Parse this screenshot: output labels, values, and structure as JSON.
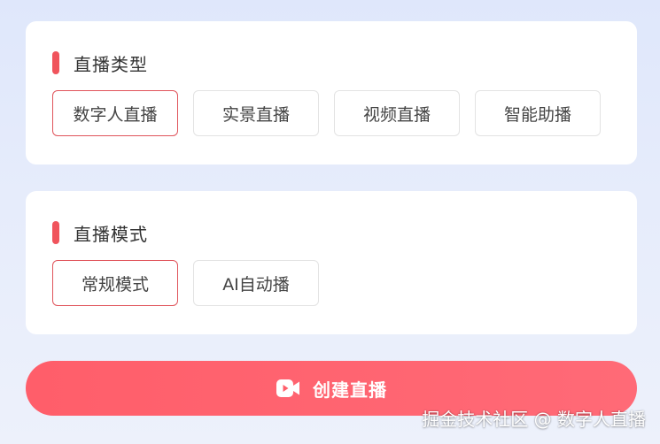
{
  "colors": {
    "accent": "#f0545c",
    "selected_border": "#e0545b",
    "button_gradient_start": "#ff5e6a",
    "button_gradient_end": "#ff6a77"
  },
  "live_type": {
    "title": "直播类型",
    "options": [
      {
        "label": "数字人直播",
        "selected": true
      },
      {
        "label": "实景直播",
        "selected": false
      },
      {
        "label": "视频直播",
        "selected": false
      },
      {
        "label": "智能助播",
        "selected": false
      }
    ]
  },
  "live_mode": {
    "title": "直播模式",
    "options": [
      {
        "label": "常规模式",
        "selected": true
      },
      {
        "label": "AI自动播",
        "selected": false
      }
    ]
  },
  "action": {
    "icon": "video-camera-icon",
    "label": "创建直播"
  },
  "watermark": "掘金技术社区 @ 数字人直播"
}
